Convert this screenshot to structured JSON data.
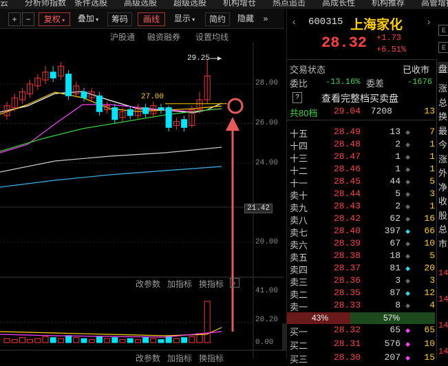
{
  "top_menu": [
    "云",
    "分析师指数",
    "条件选股",
    "高级选股",
    "超级选股",
    "机构增仓",
    "热点追击",
    "高成长性",
    "机构推荐",
    "高管增持"
  ],
  "toolbar": {
    "plus": "+",
    "minus": "−",
    "fuquan": "复权",
    "diejia": "叠加",
    "choumao": "筹码",
    "huaxian": "画线",
    "xianshi": "显示",
    "jianyue": "简约",
    "yincang": "隐藏",
    "more": "»"
  },
  "sub_toolbar": [
    "沪股通",
    "融资融券",
    "设置均线"
  ],
  "chart": {
    "high_label": "29.25",
    "ma_label": "27.00",
    "price_axis": [
      "28.00",
      "26.00",
      "24.00",
      "21.42",
      "20.00"
    ],
    "vol_axis": [
      "41.00",
      "20.20",
      "0.00"
    ],
    "indicator_bar_1": [
      "改参数",
      "加指标",
      "换指标"
    ],
    "indicator_bar_2": [
      "改参数",
      "加指标",
      "换指标"
    ],
    "candles": [
      {
        "o": 26.4,
        "c": 26.9,
        "h": 27.1,
        "l": 26.2
      },
      {
        "o": 26.8,
        "c": 27.3,
        "h": 27.5,
        "l": 26.6
      },
      {
        "o": 27.2,
        "c": 27.6,
        "h": 27.8,
        "l": 27.0
      },
      {
        "o": 27.5,
        "c": 28.0,
        "h": 28.2,
        "l": 27.3
      },
      {
        "o": 27.9,
        "c": 28.3,
        "h": 28.5,
        "l": 27.7
      },
      {
        "o": 28.2,
        "c": 28.6,
        "h": 28.9,
        "l": 28.0
      },
      {
        "o": 28.6,
        "c": 28.3,
        "h": 28.9,
        "l": 28.1
      },
      {
        "o": 28.4,
        "c": 28.9,
        "h": 29.1,
        "l": 28.2
      },
      {
        "o": 28.5,
        "c": 27.4,
        "h": 28.7,
        "l": 27.2
      },
      {
        "o": 27.5,
        "c": 27.9,
        "h": 28.1,
        "l": 27.3
      },
      {
        "o": 27.6,
        "c": 27.3,
        "h": 27.8,
        "l": 27.1
      },
      {
        "o": 27.3,
        "c": 27.6,
        "h": 27.8,
        "l": 27.1
      },
      {
        "o": 27.4,
        "c": 26.6,
        "h": 27.6,
        "l": 26.4
      },
      {
        "o": 26.7,
        "c": 26.9,
        "h": 27.1,
        "l": 26.5
      },
      {
        "o": 26.8,
        "c": 26.2,
        "h": 27.0,
        "l": 26.0
      },
      {
        "o": 26.3,
        "c": 26.6,
        "h": 26.8,
        "l": 26.1
      },
      {
        "o": 26.7,
        "c": 26.4,
        "h": 26.9,
        "l": 26.2
      },
      {
        "o": 26.4,
        "c": 26.8,
        "h": 27.0,
        "l": 26.2
      },
      {
        "o": 26.8,
        "c": 26.5,
        "h": 27.0,
        "l": 26.3
      },
      {
        "o": 26.5,
        "c": 26.9,
        "h": 27.1,
        "l": 26.3
      },
      {
        "o": 26.8,
        "c": 26.7,
        "h": 27.0,
        "l": 26.5
      },
      {
        "o": 26.8,
        "c": 25.8,
        "h": 26.9,
        "l": 25.6
      },
      {
        "o": 25.9,
        "c": 26.1,
        "h": 26.3,
        "l": 25.7
      },
      {
        "o": 26.2,
        "c": 25.8,
        "h": 26.4,
        "l": 25.6
      },
      {
        "o": 25.9,
        "c": 26.7,
        "h": 26.9,
        "l": 25.8
      },
      {
        "o": 26.7,
        "c": 27.2,
        "h": 27.6,
        "l": 26.5
      },
      {
        "o": 27.2,
        "c": 28.4,
        "h": 29.25,
        "l": 27.0
      }
    ],
    "volumes": [
      4,
      3,
      5,
      3,
      4,
      6,
      5,
      4,
      7,
      5,
      4,
      3,
      6,
      4,
      5,
      3,
      4,
      3,
      5,
      4,
      3,
      6,
      4,
      5,
      6,
      9,
      41
    ]
  },
  "stock": {
    "code": "600315",
    "name": "上海家化",
    "price": "28.32",
    "change": "+1.73",
    "change_pct": "+6.51%",
    "status_label": "交易状态",
    "status_value": "已收市",
    "weibi_label": "委比",
    "weibi_value": "-13.16%",
    "weicha_label": "委差",
    "weicha_value": "-1676",
    "help_icon_text": "?",
    "full_book_link": "查看完整档买卖盘",
    "total_levels": "共80档",
    "total_price": "29.04",
    "total_vol": "7208",
    "total_cnt": "13",
    "buy_ratio": "43%",
    "sell_ratio": "57%"
  },
  "asks": [
    {
      "label": "十五",
      "price": "28.49",
      "vol": "13",
      "dot": "gray",
      "cnt": "7"
    },
    {
      "label": "十四",
      "price": "28.48",
      "vol": "2",
      "dot": "gray",
      "cnt": "1"
    },
    {
      "label": "十三",
      "price": "28.47",
      "vol": "1",
      "dot": "gray",
      "cnt": "1"
    },
    {
      "label": "十二",
      "price": "28.46",
      "vol": "1",
      "dot": "gray",
      "cnt": "1"
    },
    {
      "label": "十一",
      "price": "28.45",
      "vol": "44",
      "dot": "gray",
      "cnt": "5"
    },
    {
      "label": "卖十",
      "price": "28.44",
      "vol": "5",
      "dot": "gray",
      "cnt": "3"
    },
    {
      "label": "卖九",
      "price": "28.43",
      "vol": "2",
      "dot": "gray",
      "cnt": "1"
    },
    {
      "label": "卖八",
      "price": "28.42",
      "vol": "62",
      "dot": "gray",
      "cnt": "16"
    },
    {
      "label": "卖七",
      "price": "28.40",
      "vol": "397",
      "dot": "cyan",
      "cnt": "66"
    },
    {
      "label": "卖六",
      "price": "28.39",
      "vol": "67",
      "dot": "gray",
      "cnt": "10"
    },
    {
      "label": "卖五",
      "price": "28.38",
      "vol": "18",
      "dot": "gray",
      "cnt": "5"
    },
    {
      "label": "卖四",
      "price": "28.37",
      "vol": "81",
      "dot": "cyan",
      "cnt": "20"
    },
    {
      "label": "卖三",
      "price": "28.36",
      "vol": "3",
      "dot": "gray",
      "cnt": "3"
    },
    {
      "label": "卖二",
      "price": "28.35",
      "vol": "87",
      "dot": "cyan",
      "cnt": "12"
    },
    {
      "label": "卖一",
      "price": "28.33",
      "vol": "8",
      "dot": "gray",
      "cnt": "4"
    }
  ],
  "bids": [
    {
      "label": "买一",
      "price": "28.32",
      "vol": "65",
      "dot": "magenta",
      "cnt": "65"
    },
    {
      "label": "买二",
      "price": "28.31",
      "vol": "576",
      "dot": "magenta",
      "cnt": "10"
    },
    {
      "label": "买三",
      "price": "28.30",
      "vol": "207",
      "dot": "magenta",
      "cnt": "15"
    }
  ],
  "side_tab": [
    "盘",
    "涨",
    "总",
    "换",
    "最",
    "今",
    "涨",
    "外",
    "净",
    "收",
    "股",
    "总",
    "市"
  ],
  "side_nums": [
    "14",
    "14",
    "14",
    "14"
  ],
  "colors": {
    "up": "#ff3333",
    "down": "#00e5ff",
    "ma5": "#ffffff",
    "ma10": "#ffd000",
    "ma20": "#ff40ff",
    "ma30": "#36d536",
    "ma60": "#c8c8c8",
    "ma120": "#3bb5e8",
    "annotation": "#e85a5a"
  }
}
